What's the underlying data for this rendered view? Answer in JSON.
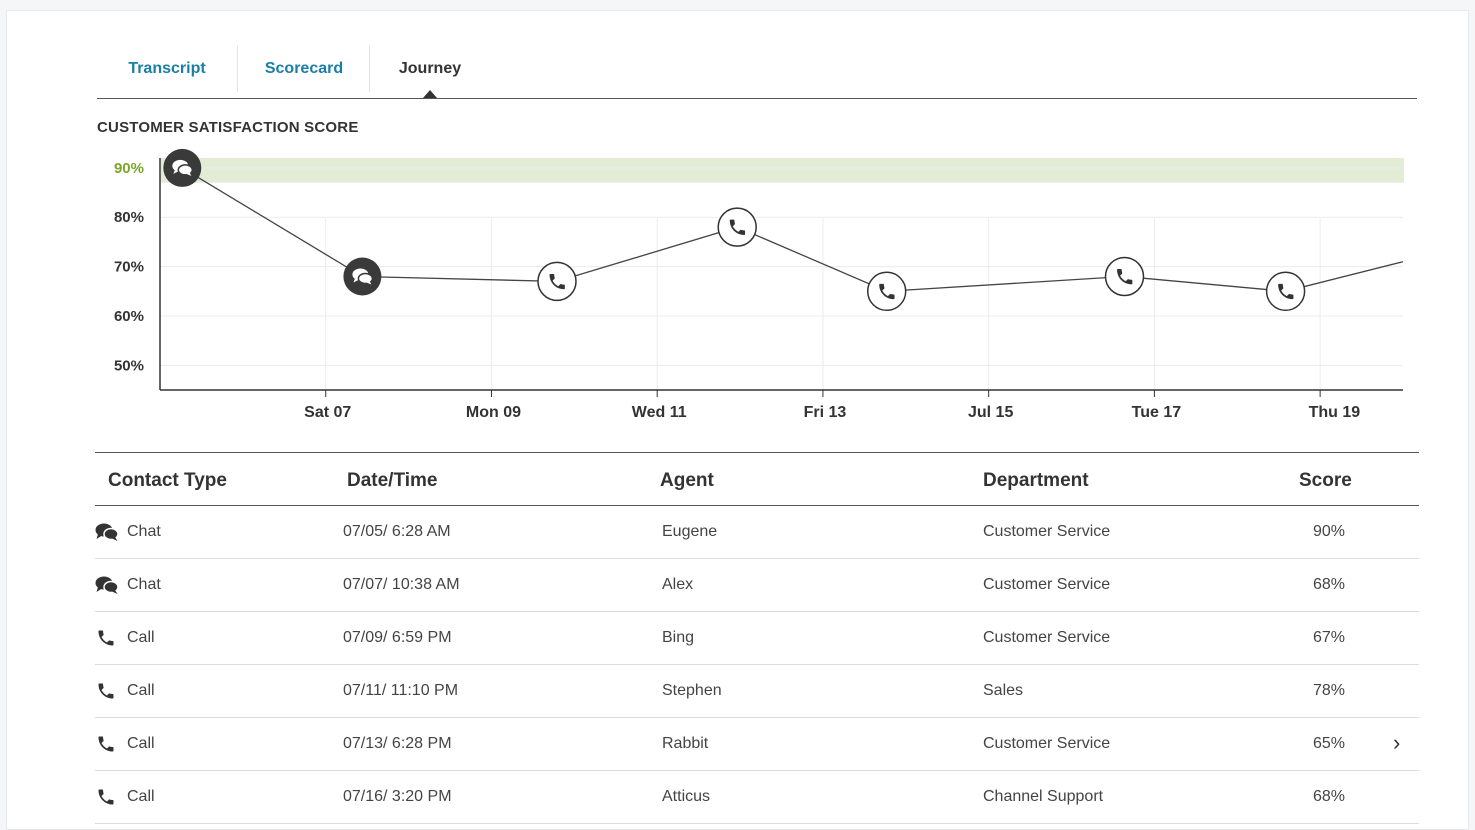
{
  "tabs": [
    {
      "label": "Transcript",
      "active": false
    },
    {
      "label": "Scorecard",
      "active": false
    },
    {
      "label": "Journey",
      "active": true
    }
  ],
  "section_title": "CUSTOMER SATISFACTION SCORE",
  "colors": {
    "accent": "#1a7ea6",
    "target_band": "#e3ecd5",
    "target_label": "#7aa72a",
    "marker_dark": "#3a3a3a",
    "line": "#444444"
  },
  "chart_data": {
    "type": "line",
    "title": "CUSTOMER SATISFACTION SCORE",
    "ylim": [
      45,
      92
    ],
    "y_ticks": [
      {
        "value": 90,
        "label": "90%",
        "highlight": true
      },
      {
        "value": 80,
        "label": "80%"
      },
      {
        "value": 70,
        "label": "70%"
      },
      {
        "value": 60,
        "label": "60%"
      },
      {
        "value": 50,
        "label": "50%"
      }
    ],
    "target_band": [
      87,
      92
    ],
    "x_range": [
      "07/05",
      "07/20"
    ],
    "x_ticks": [
      {
        "date": "07/07",
        "label": "Sat 07"
      },
      {
        "date": "07/09",
        "label": "Mon 09"
      },
      {
        "date": "07/11",
        "label": "Wed 11"
      },
      {
        "date": "07/13",
        "label": "Fri 13"
      },
      {
        "date": "07/15",
        "label": "Jul 15"
      },
      {
        "date": "07/17",
        "label": "Tue 17"
      },
      {
        "date": "07/19",
        "label": "Thu 19"
      }
    ],
    "series": [
      {
        "points": [
          {
            "x": "07/05 6:28 AM",
            "y": 90,
            "kind": "chat"
          },
          {
            "x": "07/07 10:38 AM",
            "y": 68,
            "kind": "chat"
          },
          {
            "x": "07/09 6:59 PM",
            "y": 67,
            "kind": "call"
          },
          {
            "x": "07/11 11:10 PM",
            "y": 78,
            "kind": "call"
          },
          {
            "x": "07/13 6:28 PM",
            "y": 65,
            "kind": "call"
          },
          {
            "x": "07/16 3:20 PM",
            "y": 68,
            "kind": "call"
          },
          {
            "x": "07/18 2:00 PM",
            "y": 65,
            "kind": "call"
          },
          {
            "x": "07/20 12:00 AM",
            "y": 71
          }
        ]
      }
    ],
    "grid": true
  },
  "table": {
    "headers": {
      "contact_type": "Contact Type",
      "datetime": "Date/Time",
      "agent": "Agent",
      "department": "Department",
      "score": "Score"
    },
    "rows": [
      {
        "icon": "chat-icon",
        "type": "Chat",
        "datetime": "07/05/ 6:28 AM",
        "agent": "Eugene",
        "department": "Customer Service",
        "score": "90%"
      },
      {
        "icon": "chat-icon",
        "type": "Chat",
        "datetime": "07/07/ 10:38 AM",
        "agent": "Alex",
        "department": "Customer Service",
        "score": "68%"
      },
      {
        "icon": "phone-icon",
        "type": "Call",
        "datetime": "07/09/ 6:59 PM",
        "agent": "Bing",
        "department": "Customer Service",
        "score": "67%"
      },
      {
        "icon": "phone-icon",
        "type": "Call",
        "datetime": "07/11/ 11:10 PM",
        "agent": "Stephen",
        "department": "Sales",
        "score": "78%"
      },
      {
        "icon": "phone-icon",
        "type": "Call",
        "datetime": "07/13/ 6:28 PM",
        "agent": "Rabbit",
        "department": "Customer Service",
        "score": "65%",
        "expandable": true
      },
      {
        "icon": "phone-icon",
        "type": "Call",
        "datetime": "07/16/ 3:20 PM",
        "agent": "Atticus",
        "department": "Channel Support",
        "score": "68%"
      }
    ],
    "chevron_glyph": "›"
  }
}
